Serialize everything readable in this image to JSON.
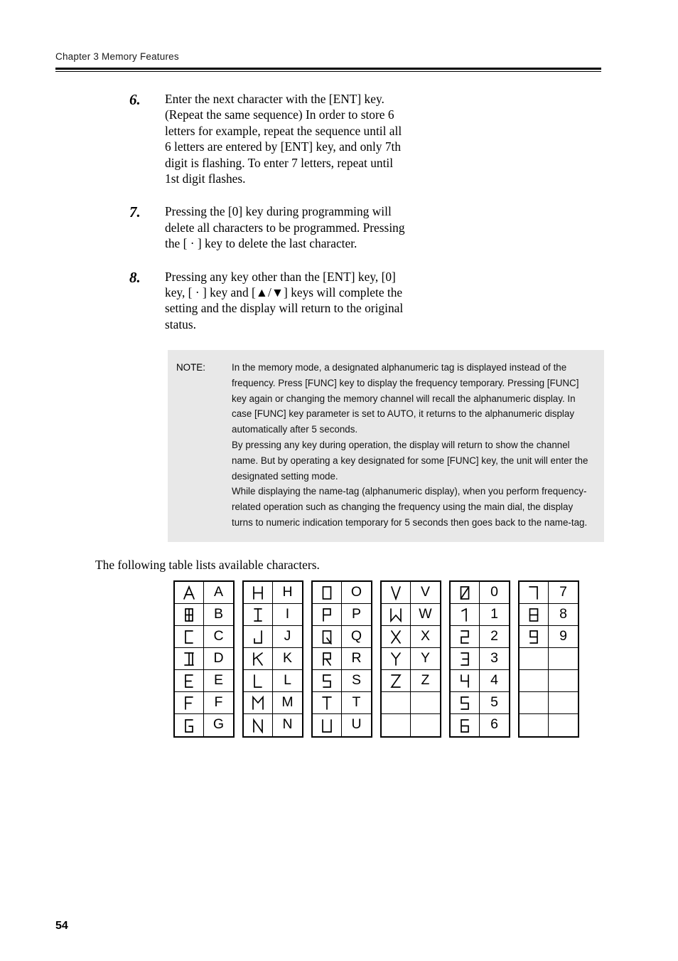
{
  "header": {
    "chapter": "Chapter 3   Memory Features"
  },
  "steps": [
    {
      "number": "6.",
      "text": "Enter the next character with the [ENT] key. (Repeat the same sequence) In order to store 6 letters for example, repeat the sequence until all 6 letters are entered by [ENT] key, and only 7th digit is flashing. To enter 7 letters, repeat until 1st digit flashes."
    },
    {
      "number": "7.",
      "text": "Pressing the [0] key during programming will delete all characters to be programmed. Pressing the [ · ] key to delete the last character."
    },
    {
      "number": "8.",
      "text": "Pressing any key other than the [ENT] key, [0] key, [ · ] key and [▲/▼] keys will complete the setting and the display will return to the original status."
    }
  ],
  "note": {
    "label": "NOTE:",
    "paragraphs": [
      "In the memory mode, a designated alphanumeric tag is displayed instead of the frequency. Press [FUNC] key to display the frequency temporary. Pressing [FUNC] key again or changing the memory channel will recall the alphanumeric display. In case [FUNC] key parameter is set to AUTO, it returns to the alphanumeric display automatically after 5 seconds.",
      "By pressing any key during operation, the display will return to show the channel name. But by operating a key designated for some [FUNC] key, the unit will enter the designated setting mode.",
      "While displaying the name-tag (alphanumeric display), when you perform frequency-related operation such as changing the frequency using the main dial, the display turns to numeric indication temporary for 5 seconds then goes back to the name-tag."
    ]
  },
  "table_intro": "The following table lists available characters.",
  "char_table": {
    "columns": [
      {
        "chars": [
          "A",
          "B",
          "C",
          "D",
          "E",
          "F",
          "G"
        ]
      },
      {
        "chars": [
          "H",
          "I",
          "J",
          "K",
          "L",
          "M",
          "N"
        ]
      },
      {
        "chars": [
          "O",
          "P",
          "Q",
          "R",
          "S",
          "T",
          "U"
        ]
      },
      {
        "chars": [
          "V",
          "W",
          "X",
          "Y",
          "Z",
          "",
          ""
        ]
      },
      {
        "chars": [
          "0",
          "1",
          "2",
          "3",
          "4",
          "5",
          "6"
        ]
      },
      {
        "chars": [
          "7",
          "8",
          "9",
          "",
          "",
          "",
          ""
        ]
      }
    ]
  },
  "footer": {
    "page_number": "54"
  }
}
